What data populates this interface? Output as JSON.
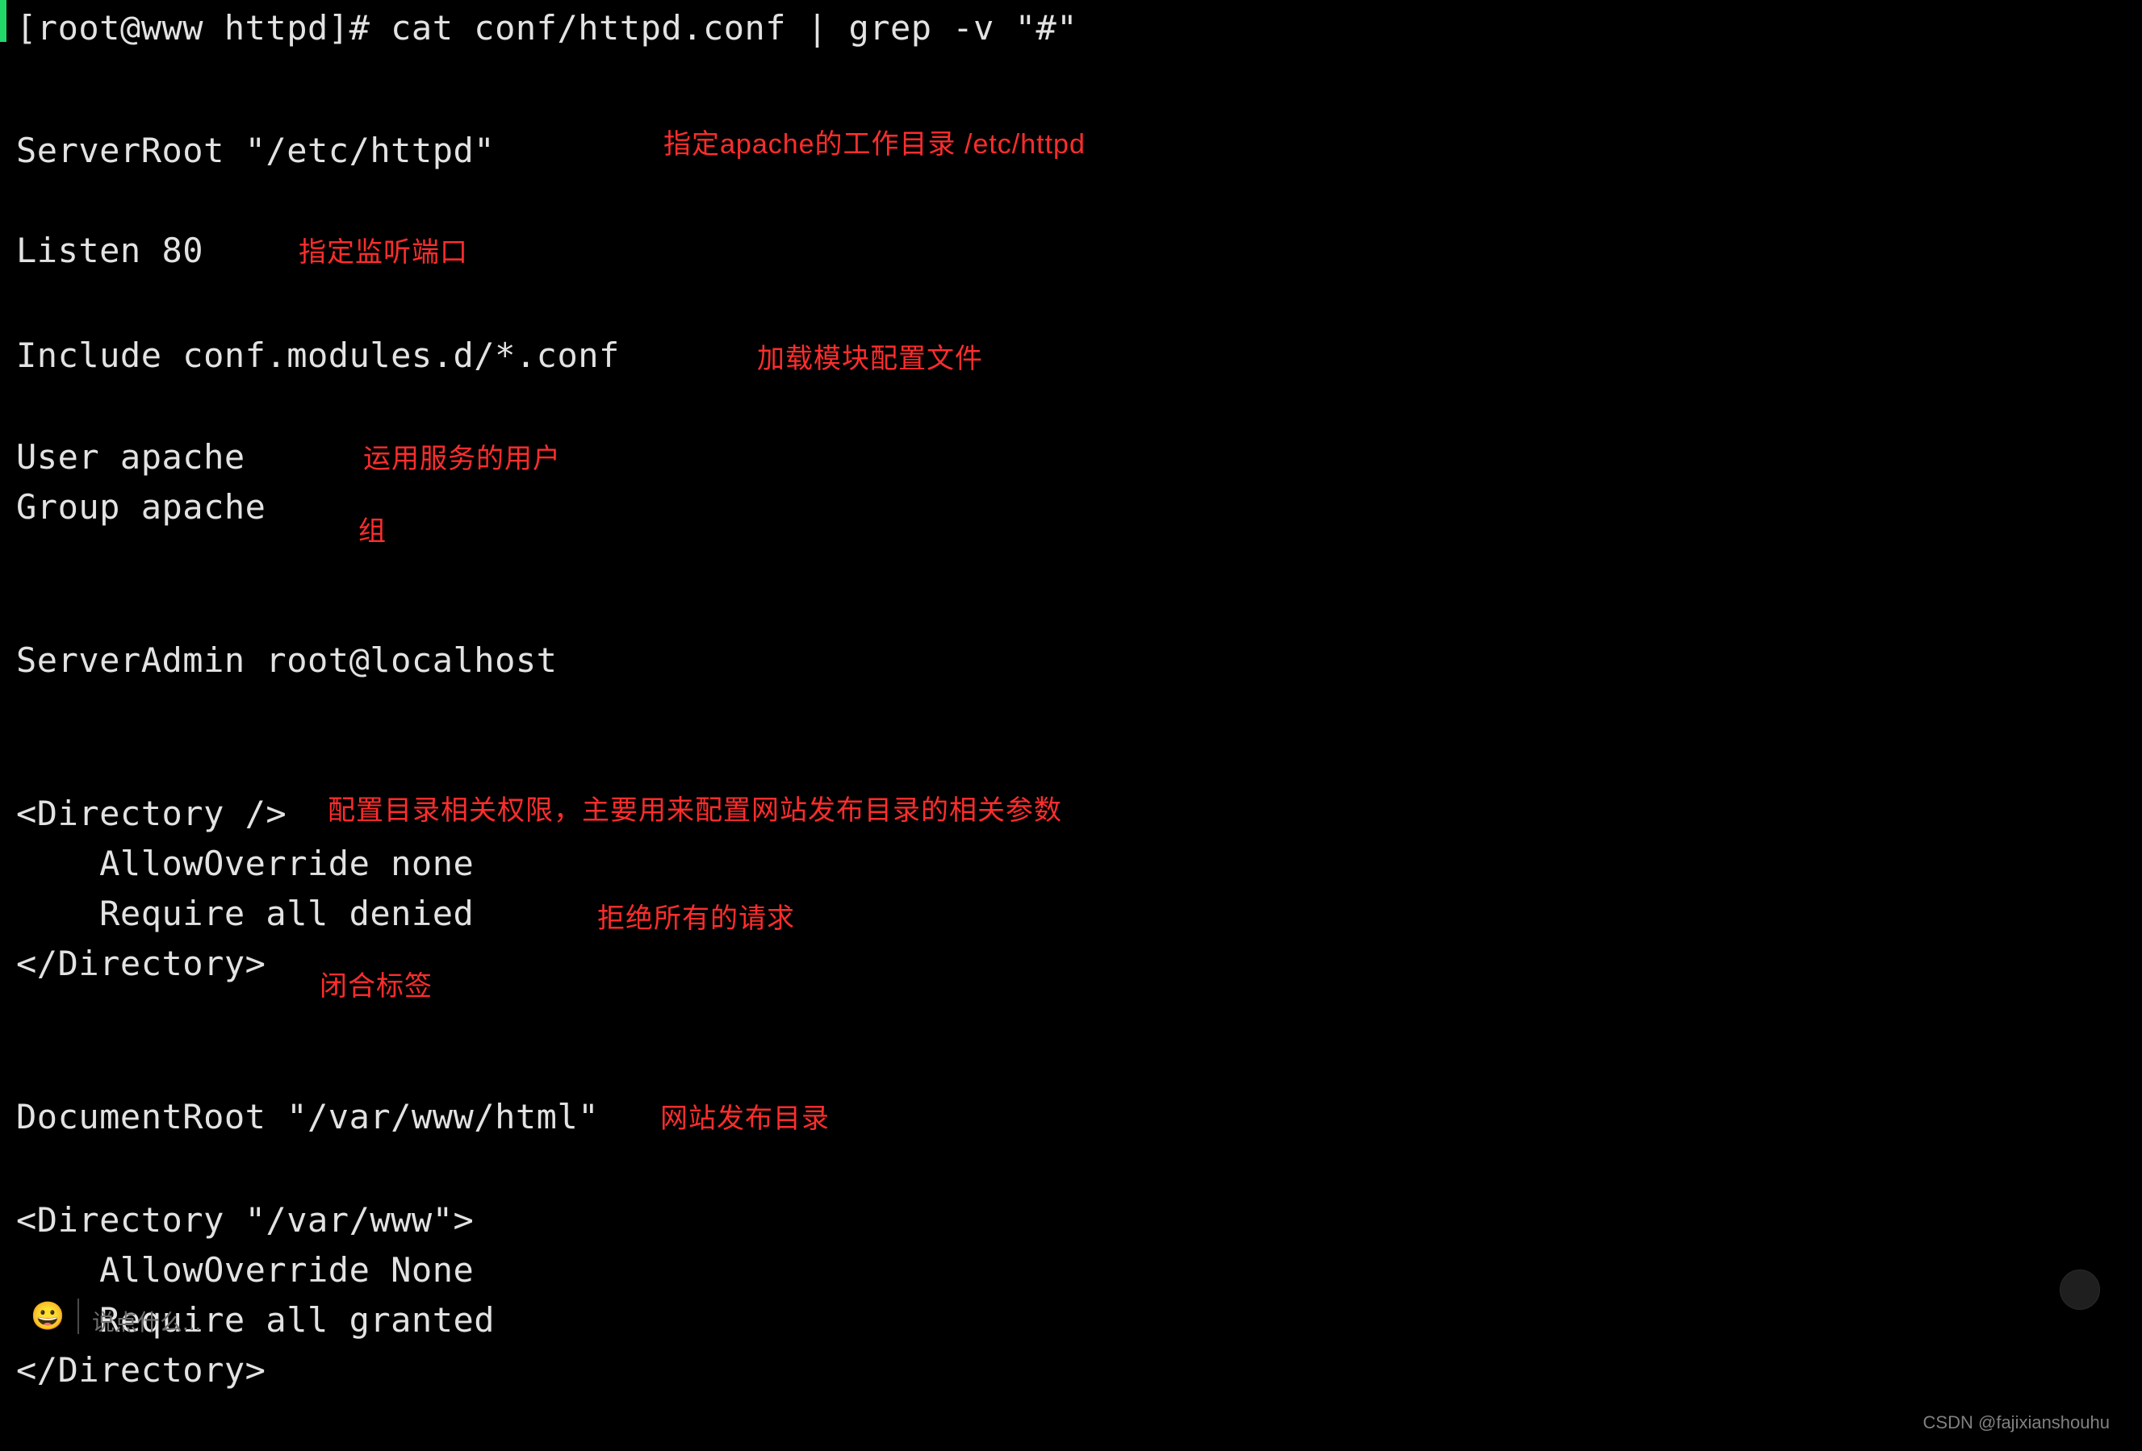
{
  "prompt": "[root@www httpd]# cat conf/httpd.conf | grep -v \"#\"",
  "lines": {
    "serverRoot": "ServerRoot \"/etc/httpd\"",
    "listen": "Listen 80",
    "include": "Include conf.modules.d/*.conf",
    "user": "User apache",
    "group": "Group apache",
    "serverAdmin": "ServerAdmin root@localhost",
    "dirOpen": "<Directory />",
    "allowOverrideNone": "    AllowOverride none",
    "requireDenied": "    Require all denied",
    "dirClose": "</Directory>",
    "documentRoot": "DocumentRoot \"/var/www/html\"",
    "dir2Open": "<Directory \"/var/www\">",
    "allowOverrideNone2": "    AllowOverride None",
    "requireGranted": "    Require all granted",
    "dir2Close": "</Directory>"
  },
  "annotations": {
    "serverRoot": "指定apache的工作目录  /etc/httpd",
    "listen": "指定监听端口",
    "include": "加载模块配置文件",
    "user": "运用服务的用户",
    "group": "组",
    "directory": "配置目录相关权限，主要用来配置网站发布目录的相关参数",
    "requireDenied": "拒绝所有的请求",
    "closeTag": "闭合标签",
    "documentRoot": "网站发布目录"
  },
  "overlay": {
    "emoji": "😀",
    "inputHint": "说点什么..."
  },
  "watermark": "CSDN @fajixianshouhu"
}
